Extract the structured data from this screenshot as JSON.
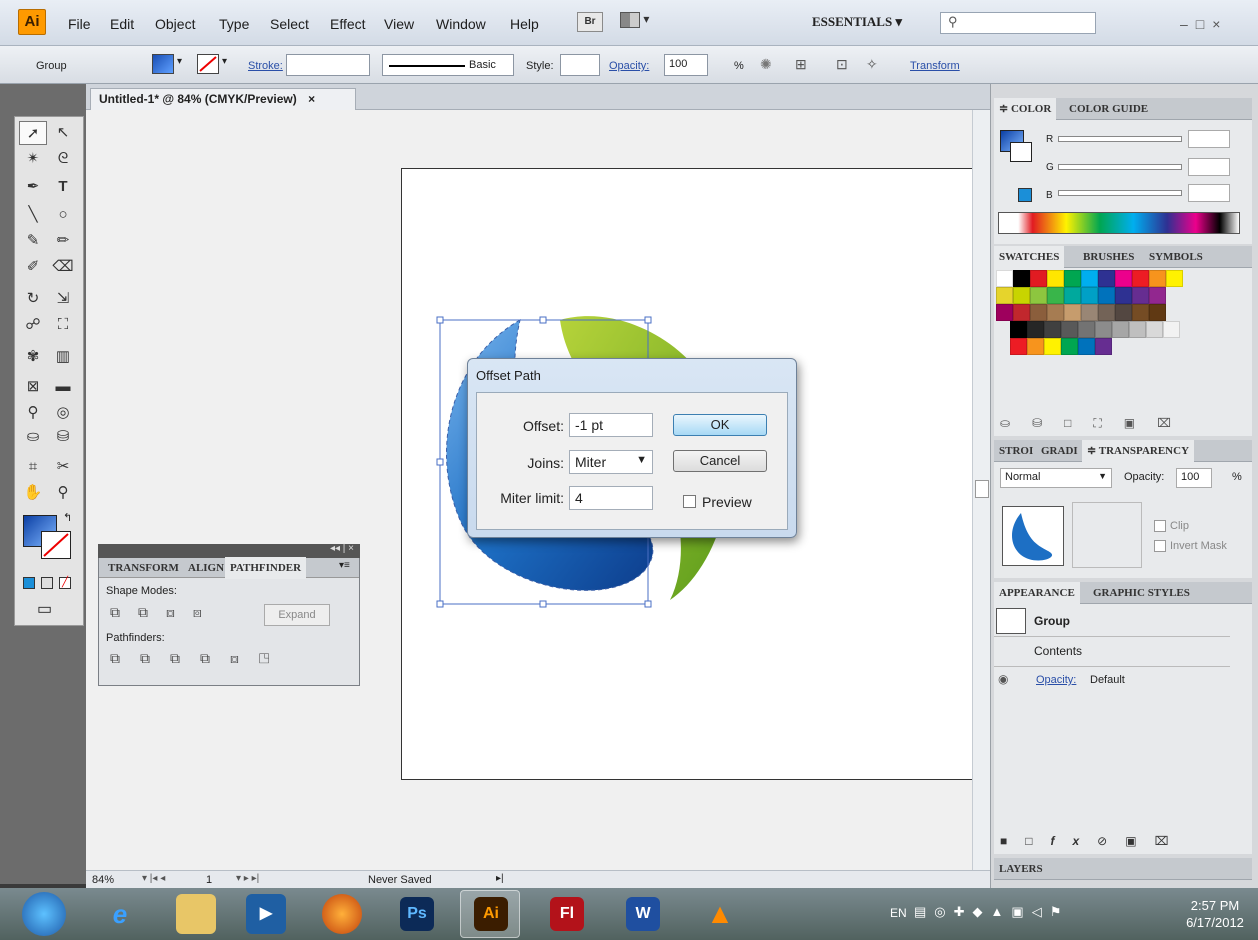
{
  "app": {
    "logo": "Ai"
  },
  "menu": {
    "items": [
      "File",
      "Edit",
      "Object",
      "Type",
      "Select",
      "Effect",
      "View",
      "Window",
      "Help"
    ],
    "bridge_label": "Br",
    "workspace": "ESSENTIALS ▾",
    "search_placeholder": ""
  },
  "control_bar": {
    "selection": "Group",
    "stroke_label": "Stroke:",
    "brush_label": "Basic",
    "style_label": "Style:",
    "opacity_label": "Opacity:",
    "opacity_value": "100",
    "opacity_unit": "%",
    "transform_label": "Transform"
  },
  "document": {
    "tab_title": "Untitled-1* @ 84% (CMYK/Preview)",
    "tab_close": "×",
    "zoom": "84%",
    "artboard_number": "1",
    "save_status": "Never Saved"
  },
  "dialog": {
    "title": "Offset Path",
    "offset_label": "Offset:",
    "offset_value": "-1 pt",
    "joins_label": "Joins:",
    "joins_value": "Miter",
    "miter_label": "Miter limit:",
    "miter_value": "4",
    "ok_label": "OK",
    "cancel_label": "Cancel",
    "preview_label": "Preview",
    "preview_checked": false
  },
  "pathfinder_panel": {
    "tabs": [
      "TRANSFORM",
      "ALIGN",
      "PATHFINDER"
    ],
    "active_tab": "PATHFINDER",
    "shape_modes_label": "Shape Modes:",
    "expand_label": "Expand",
    "pathfinders_label": "Pathfinders:"
  },
  "color_panel": {
    "tabs": [
      "≑ COLOR",
      "COLOR GUIDE"
    ],
    "channels": [
      "R",
      "G",
      "B"
    ]
  },
  "swatches_panel": {
    "tabs": [
      "SWATCHES",
      "BRUSHES",
      "SYMBOLS"
    ],
    "row1": [
      "#ffffff",
      "#000000",
      "#e11b22",
      "#ffe600",
      "#00a651",
      "#00aeef",
      "#2e3192",
      "#ec008c",
      "#ed1c24",
      "#f7941d",
      "#fff200"
    ],
    "row2": [
      "#e6d42c",
      "#c8d400",
      "#8dc63f",
      "#39b54a",
      "#00a99d",
      "#00a0c6",
      "#0072bc",
      "#2e3192",
      "#662d91",
      "#92278f"
    ],
    "row3": [
      "#9e005d",
      "#c1272d",
      "#8b5e3c",
      "#a67c52",
      "#c69c6d",
      "#998675",
      "#736357",
      "#534741",
      "#754c24",
      "#603913"
    ],
    "grays": [
      "#000000",
      "#262626",
      "#404040",
      "#595959",
      "#737373",
      "#8c8c8c",
      "#a6a6a6",
      "#bfbfbf",
      "#d9d9d9",
      "#f2f2f2"
    ],
    "brights": [
      "#ed1c24",
      "#f7941d",
      "#fff200",
      "#00a651",
      "#0072bc",
      "#662d91"
    ]
  },
  "transparency_panel": {
    "tabs": [
      "STROI",
      "GRADI",
      "≑ TRANSPARENCY"
    ],
    "blend_mode": "Normal",
    "opacity_label": "Opacity:",
    "opacity_value": "100",
    "opacity_unit": "%",
    "clip_label": "Clip",
    "invert_label": "Invert Mask"
  },
  "appearance_panel": {
    "tabs": [
      "APPEARANCE",
      "GRAPHIC STYLES"
    ],
    "group_label": "Group",
    "contents_label": "Contents",
    "opacity_label": "Opacity:",
    "opacity_value": "Default",
    "fx_label": "fx"
  },
  "layers_panel": {
    "title": "LAYERS"
  },
  "taskbar": {
    "apps": [
      "Ps",
      "Ai",
      "Fl",
      "W"
    ],
    "lang": "EN",
    "time": "2:57 PM",
    "date": "6/17/2012"
  }
}
